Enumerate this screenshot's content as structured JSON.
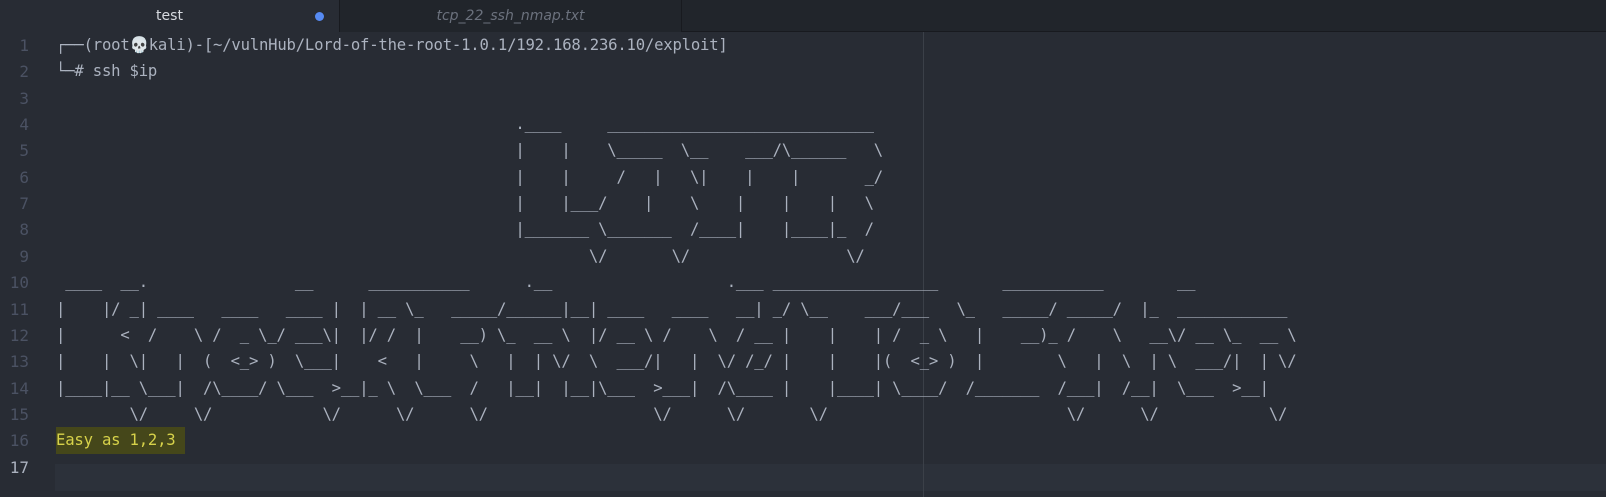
{
  "tabs": [
    {
      "title": "test",
      "modified": true,
      "active": true
    },
    {
      "title": "tcp_22_ssh_nmap.txt",
      "modified": false,
      "active": false
    }
  ],
  "colors": {
    "background": "#282c34",
    "tab_bar": "#21252b",
    "modified_dot": "#568af2",
    "highlight_bg": "#45471a",
    "highlight_text": "#d7d24a"
  },
  "editor": {
    "current_line": 17,
    "lines": [
      {
        "number": "1",
        "text": "┌──(root💀kali)-[~/vulnHub/Lord-of-the-root-1.0.1/192.168.236.10/exploit]"
      },
      {
        "number": "2",
        "text": "└─# ssh $ip"
      },
      {
        "number": "3",
        "text": ""
      },
      {
        "number": "4",
        "text": "                                                  .____     _____________________________"
      },
      {
        "number": "5",
        "text": "                                                  |    |    \\_____  \\__    ___/\\______   \\"
      },
      {
        "number": "6",
        "text": "                                                  |    |     /   |   \\|    |    |       _/"
      },
      {
        "number": "7",
        "text": "                                                  |    |___/    |    \\    |    |    |   \\"
      },
      {
        "number": "8",
        "text": "                                                  |_______ \\_______  /____|    |____|_  /"
      },
      {
        "number": "9",
        "text": "                                                          \\/       \\/                 \\/"
      },
      {
        "number": "10",
        "text": " ____  __.                __      ___________      .__                   .___ __________________       ___________        __"
      },
      {
        "number": "11",
        "text": "|    |/ _| ____   ____   ____ |  | __ \\_   _____/______|__| ____   ____   __| _/ \\__    ___/___   \\_   _____/ _____/  |_  ____________"
      },
      {
        "number": "12",
        "text": "|      <  /    \\ /  _ \\_/ ___\\|  |/ /  |    __) \\_  __ \\  |/ __ \\ /    \\  / __ |    |    | /  _ \\   |    __)_ /    \\   __\\/ __ \\_  __ \\"
      },
      {
        "number": "13",
        "text": "|    |  \\|   |  (  <_> )  \\___|    <   |     \\   |  | \\/  \\  ___/|   |  \\/ /_/ |    |    |(  <_> )  |        \\   |  \\  | \\  ___/|  | \\/"
      },
      {
        "number": "14",
        "text": "|____|__ \\___|  /\\____/ \\___  >__|_ \\  \\___  /   |__|  |__|\\___  >___|  /\\____ |    |____| \\____/  /_______  /___|  /__|  \\___  >__|"
      },
      {
        "number": "15",
        "text": "        \\/     \\/            \\/      \\/      \\/                  \\/      \\/       \\/                          \\/      \\/            \\/"
      },
      {
        "number": "16",
        "text": "Easy as 1,2,3"
      },
      {
        "number": "17",
        "text": ""
      }
    ]
  }
}
